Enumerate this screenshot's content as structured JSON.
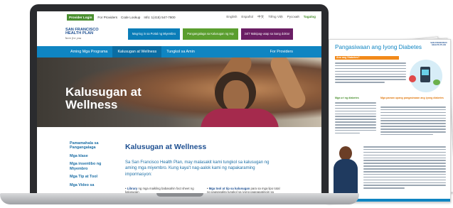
{
  "utility_bar": {
    "provider_login": "Provider Login",
    "for_providers": "For Providers",
    "code_lookup": "Code Lookup",
    "phone": "Info: 1(415) 547-7800",
    "languages": [
      "English",
      "Español",
      "中文",
      "Tiếng Việt",
      "Русский",
      "Tagalog"
    ],
    "active_language": "Tagalog"
  },
  "header": {
    "logo_line1": "SAN FRANCISCO",
    "logo_line2": "HEALTH PLAN",
    "logo_tagline": "here for you",
    "cta_buttons": [
      {
        "label": "Mag-log in sa Portal ng Miyembro",
        "color": "#0a7db8"
      },
      {
        "label": "Pangangalaga sa Kalusugan ng Isip",
        "color": "#5a9e2e"
      },
      {
        "label": "24/7 Makipag-usap sa isang doktor",
        "color": "#6a1e64"
      }
    ]
  },
  "nav": {
    "items": [
      "Aming Mga Programa",
      "Kalusugan at Wellness",
      "Tungkol sa Amin"
    ],
    "active": "Kalusugan at Wellness",
    "right_item": "For Providers"
  },
  "hero": {
    "title": "Kalusugan at Wellness"
  },
  "side_nav": {
    "items": [
      "Pamamahala sa Pangangalaga",
      "Mga klase",
      "Mga insentibo ng Miyembro",
      "Mga Tip at Tool",
      "Mga Video sa"
    ]
  },
  "main": {
    "title": "Kalusugan at Wellness",
    "intro": "Sa San Francisco Health Plan, may malasakit kami tungkol sa kalusugan ng aming mga miyembro. Kung kaya't nag-aalok kami ng napakaraming impormasyon:",
    "bullets": [
      {
        "bold": "Library",
        "text": " ng mga maikling babasahin fact sheet ng kalusugan"
      },
      {
        "bold": "Mga tool at tip sa kalusugan",
        "text": " para sa mga lipo total ng pagsasalita tungkol sa iyong pagpapatingin sa"
      }
    ]
  },
  "brochure": {
    "title": "Pangasiwaan ang Iyong Diabetes",
    "logo": "SAN FRANCISCO HEALTH PLAN",
    "section1": "Ano ang Diabetes?",
    "section2": "Mga uri ng diabetes",
    "section3": "Mga paraan upang pangasiwaan ang iyong diabetes"
  },
  "colors": {
    "brand_blue": "#0f85c2",
    "brand_navy": "#1d4f91",
    "brand_green": "#4a8f2f",
    "brand_purple": "#6a1e64",
    "accent_orange": "#f28a1a"
  }
}
